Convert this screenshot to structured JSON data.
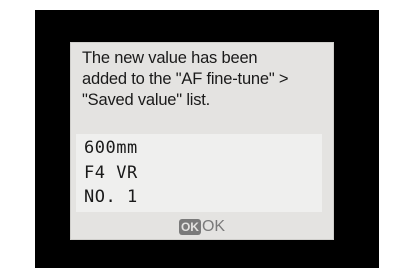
{
  "dialog": {
    "message": "The new value has been\nadded to the \"AF fine-tune\" >\n\"Saved value\" list.",
    "lens": {
      "focal_length": "600mm",
      "aperture": "F4 VR",
      "number": "NO. 1"
    },
    "ok_button": {
      "icon_text": "OK",
      "label": "OK"
    }
  }
}
